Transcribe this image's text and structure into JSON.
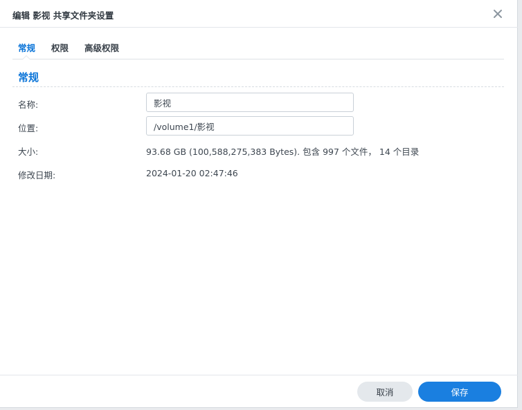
{
  "dialog": {
    "title": "编辑 影视 共享文件夹设置",
    "close_icon": "close-icon"
  },
  "tabs": [
    {
      "label": "常规",
      "active": true
    },
    {
      "label": "权限",
      "active": false
    },
    {
      "label": "高级权限",
      "active": false
    }
  ],
  "section": {
    "title": "常规"
  },
  "fields": {
    "name_label": "名称:",
    "name_value": "影视",
    "location_label": "位置:",
    "location_value": "/volume1/影视",
    "size_label": "大小:",
    "size_value": "93.68 GB (100,588,275,383 Bytes). 包含 997 个文件， 14 个目录",
    "modified_label": "修改日期:",
    "modified_value": "2024-01-20 02:47:46"
  },
  "footer": {
    "cancel_label": "取消",
    "save_label": "保存"
  },
  "colors": {
    "accent": "#0a74d8",
    "primary_button": "#1a7fe0",
    "secondary_button": "#e4e8ec"
  }
}
